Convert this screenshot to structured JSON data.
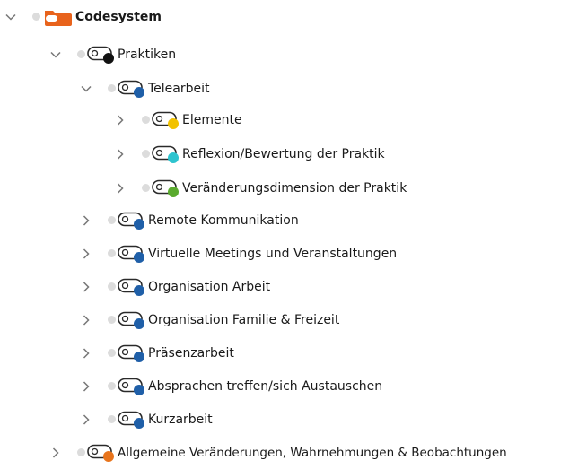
{
  "tree": {
    "root": {
      "label": "Codesystem",
      "color": "#e8631c"
    },
    "praktiken": {
      "label": "Praktiken",
      "color": "#111111"
    },
    "telearbeit": {
      "label": "Telearbeit",
      "color": "#1f5fa8"
    },
    "elemente": {
      "label": "Elemente",
      "color": "#f2c200"
    },
    "reflexion": {
      "label": "Reflexion/Bewertung der Praktik",
      "color": "#2ec4cf"
    },
    "veraenderungsdimension": {
      "label": "Veränderungsdimension der Praktik",
      "color": "#5aaa2e"
    },
    "items": [
      {
        "label": "Remote Kommunikation",
        "color": "#1f5fa8"
      },
      {
        "label": "Virtuelle Meetings und Veranstaltungen",
        "color": "#1f5fa8"
      },
      {
        "label": "Organisation Arbeit",
        "color": "#1f5fa8"
      },
      {
        "label": "Organisation Familie & Freizeit",
        "color": "#1f5fa8"
      },
      {
        "label": "Präsenzarbeit",
        "color": "#1f5fa8"
      },
      {
        "label": "Absprachen treffen/sich Austauschen",
        "color": "#1f5fa8"
      },
      {
        "label": "Kurzarbeit",
        "color": "#1f5fa8"
      }
    ],
    "allgemeine": {
      "label": "Allgemeine Veränderungen, Wahrnehmungen & Beobachtungen",
      "color": "#e8741c"
    }
  }
}
